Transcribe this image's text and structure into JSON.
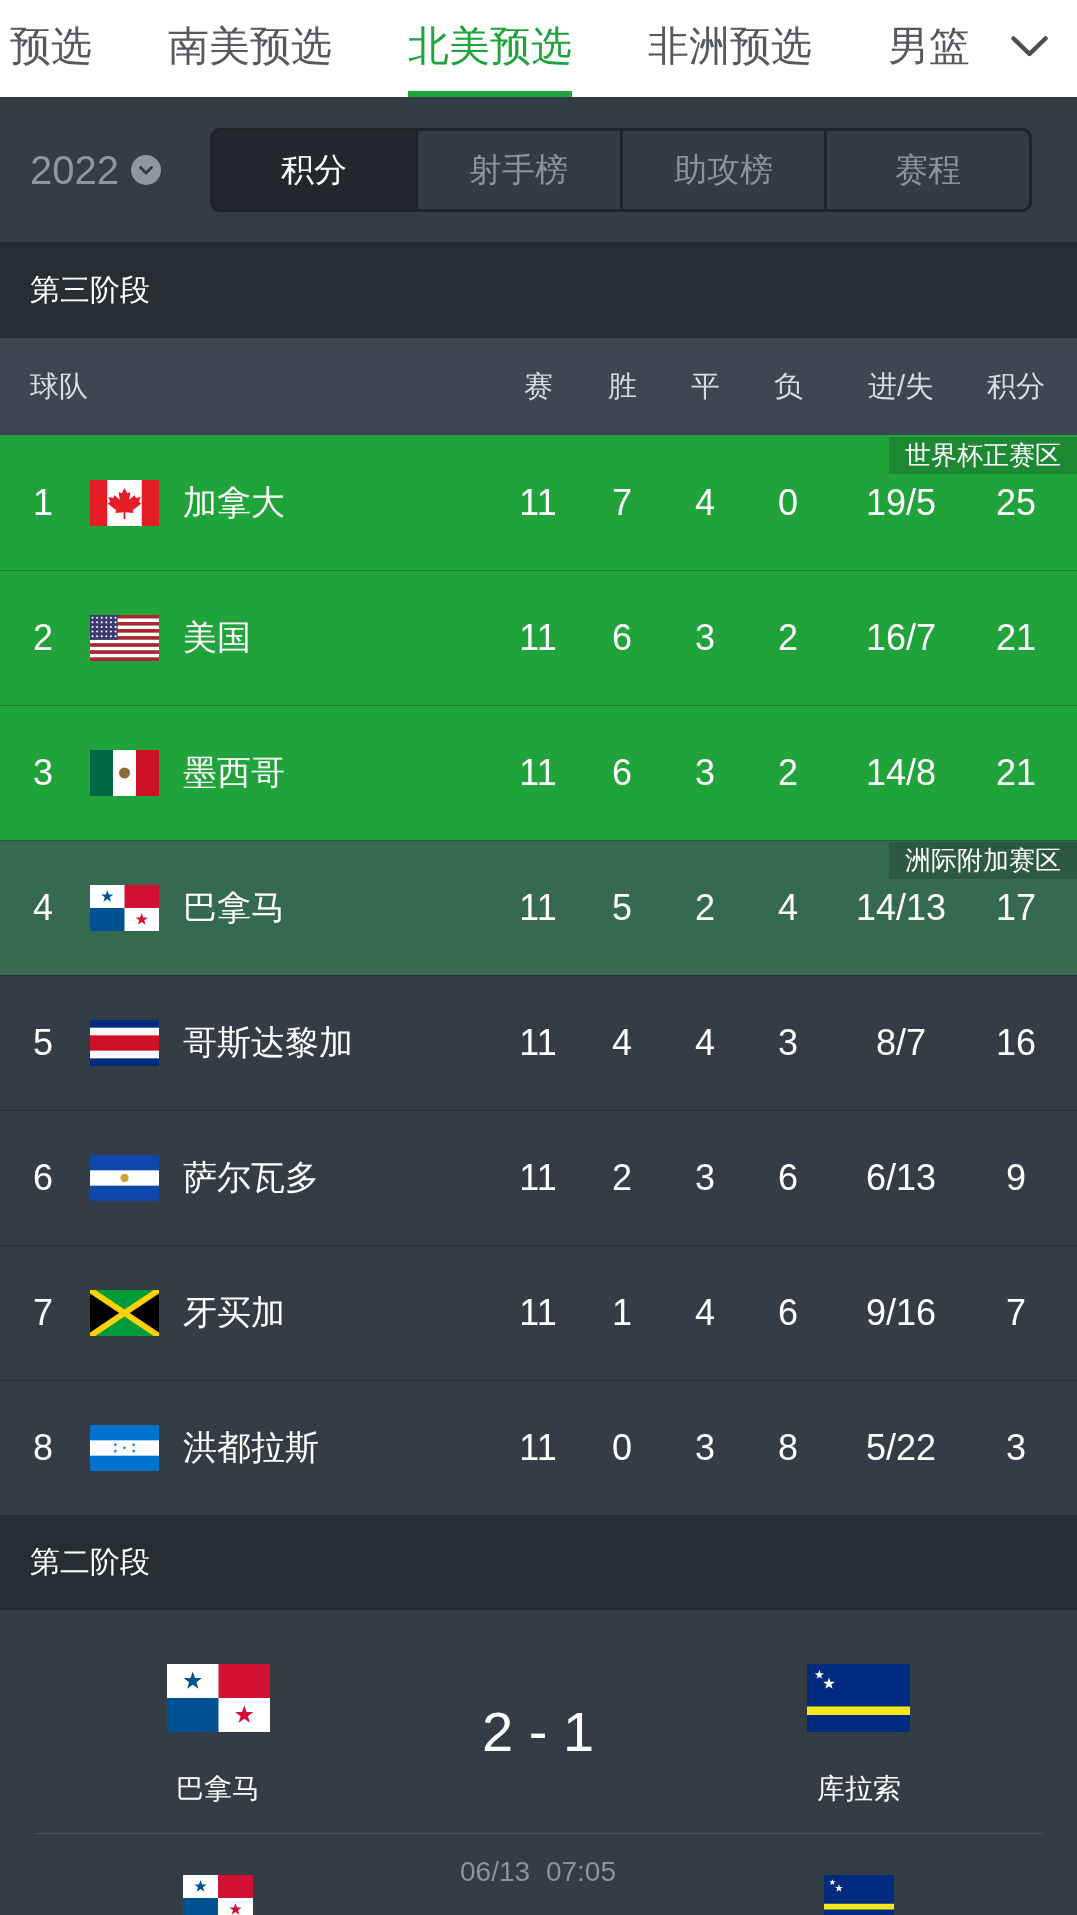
{
  "league_tabs": [
    {
      "label": "预选",
      "selected": false
    },
    {
      "label": "南美预选",
      "selected": false
    },
    {
      "label": "北美预选",
      "selected": true
    },
    {
      "label": "非洲预选",
      "selected": false
    },
    {
      "label": "男篮",
      "selected": false
    }
  ],
  "season_selector": {
    "value": "2022"
  },
  "view_tabs": [
    {
      "label": "积分",
      "selected": true
    },
    {
      "label": "射手榜",
      "selected": false
    },
    {
      "label": "助攻榜",
      "selected": false
    },
    {
      "label": "赛程",
      "selected": false
    }
  ],
  "stage_3": {
    "title": "第三阶段",
    "columns": [
      "球队",
      "赛",
      "胜",
      "平",
      "负",
      "进/失",
      "积分"
    ],
    "rows": [
      {
        "rank": "1",
        "flag": {
          "kind": "canada"
        },
        "team": "加拿大",
        "played": "11",
        "won": "7",
        "drawn": "4",
        "lost": "0",
        "goals": "19/5",
        "points": "25",
        "color": "#21a33b",
        "zone_label": "世界杯正赛区"
      },
      {
        "rank": "2",
        "flag": {
          "kind": "usa"
        },
        "team": "美国",
        "played": "11",
        "won": "6",
        "drawn": "3",
        "lost": "2",
        "goals": "16/7",
        "points": "21",
        "color": "#21a33b"
      },
      {
        "rank": "3",
        "flag": {
          "kind": "mexico"
        },
        "team": "墨西哥",
        "played": "11",
        "won": "6",
        "drawn": "3",
        "lost": "2",
        "goals": "14/8",
        "points": "21",
        "color": "#21a33b"
      },
      {
        "rank": "4",
        "flag": {
          "kind": "panama"
        },
        "team": "巴拿马",
        "played": "11",
        "won": "5",
        "drawn": "2",
        "lost": "4",
        "goals": "14/13",
        "points": "17",
        "color": "#356a50",
        "zone_label": "洲际附加赛区"
      },
      {
        "rank": "5",
        "flag": {
          "kind": "costarica"
        },
        "team": "哥斯达黎加",
        "played": "11",
        "won": "4",
        "drawn": "4",
        "lost": "3",
        "goals": "8/7",
        "points": "16",
        "color": "#343c45"
      },
      {
        "rank": "6",
        "flag": {
          "kind": "elsalvador"
        },
        "team": "萨尔瓦多",
        "played": "11",
        "won": "2",
        "drawn": "3",
        "lost": "6",
        "goals": "6/13",
        "points": "9",
        "color": "#343c45"
      },
      {
        "rank": "7",
        "flag": {
          "kind": "jamaica"
        },
        "team": "牙买加",
        "played": "11",
        "won": "1",
        "drawn": "4",
        "lost": "6",
        "goals": "9/16",
        "points": "7",
        "color": "#343c45"
      },
      {
        "rank": "8",
        "flag": {
          "kind": "honduras"
        },
        "team": "洪都拉斯",
        "played": "11",
        "won": "0",
        "drawn": "3",
        "lost": "8",
        "goals": "5/22",
        "points": "3",
        "color": "#343c45"
      }
    ]
  },
  "stage_2": {
    "title": "第二阶段",
    "matches": [
      {
        "kind": "large",
        "home": {
          "flag": {
            "kind": "panama"
          },
          "name": "巴拿马"
        },
        "away": {
          "flag": {
            "kind": "curacao"
          },
          "name": "库拉索"
        },
        "score": "2 - 1"
      },
      {
        "kind": "dated",
        "datetime": "06/13 07:05",
        "home": {
          "flag": {
            "kind": "panama"
          }
        },
        "away": {
          "flag": {
            "kind": "curacao"
          }
        }
      }
    ]
  }
}
